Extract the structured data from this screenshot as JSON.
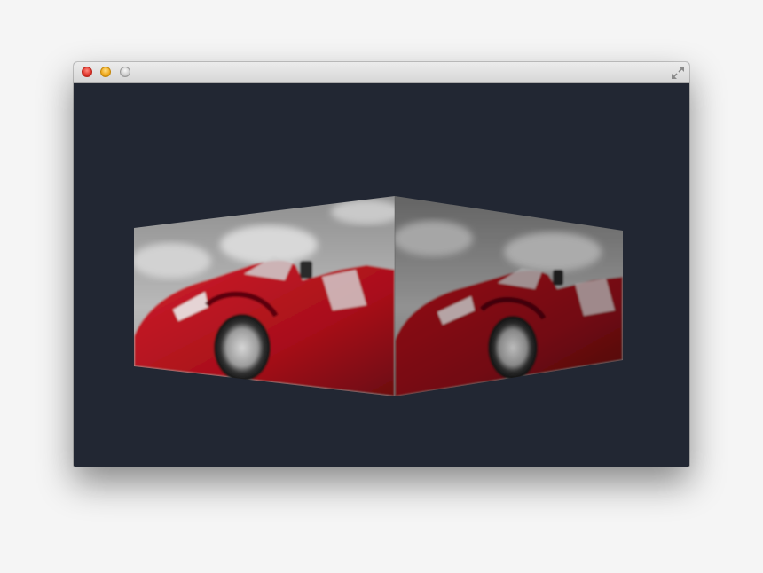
{
  "window": {
    "buttons": {
      "close": "close-button",
      "minimize": "minimize-button",
      "zoom": "zoom-button"
    },
    "fullscreen_icon": "fullscreen-arrows-icon",
    "background_color": "#222733"
  },
  "scene": {
    "description_icon": "cube-corner-with-red-car-texture",
    "car_color": "#b3101c"
  }
}
